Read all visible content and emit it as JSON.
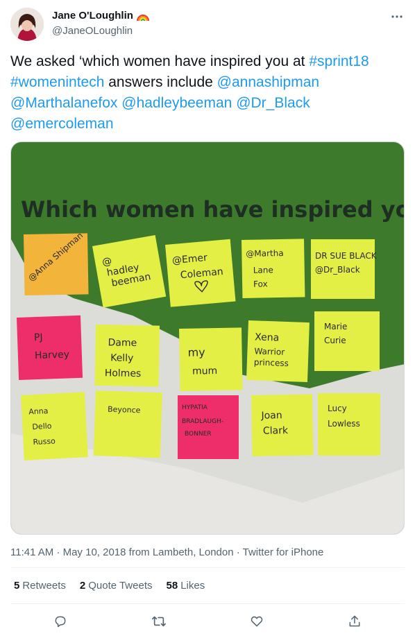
{
  "author": {
    "display_name": "Jane O'Loughlin",
    "handle": "@JaneOLoughlin",
    "badge_icon": "rainbow-icon"
  },
  "tweet": {
    "segments": [
      {
        "text": "We asked ‘which women have inspired you at ",
        "type": "text"
      },
      {
        "text": "#sprint18",
        "type": "link"
      },
      {
        "text": " ",
        "type": "text"
      },
      {
        "text": "#womenintech",
        "type": "link"
      },
      {
        "text": " answers include ",
        "type": "text"
      },
      {
        "text": "@annashipman",
        "type": "link"
      },
      {
        "text": " ",
        "type": "text"
      },
      {
        "text": "@Marthalanefox",
        "type": "link"
      },
      {
        "text": " ",
        "type": "text"
      },
      {
        "text": "@hadleybeeman",
        "type": "link"
      },
      {
        "text": " ",
        "type": "text"
      },
      {
        "text": "@Dr_Black",
        "type": "link"
      },
      {
        "text": " ",
        "type": "text"
      },
      {
        "text": "@emercoleman",
        "type": "link"
      }
    ]
  },
  "photo": {
    "heading": "Which women have inspired you",
    "notes": [
      "@Anna Shipman",
      "@hadley beeman",
      "@Emer Coleman",
      "@Martha Lane Fox",
      "DR SUE BLACK @Dr_Black",
      "PJ Harvey",
      "Dame Kelly Holmes",
      "my mum",
      "Xena Warrior princess",
      "Marie Curie",
      "Anna Dello Russo",
      "Beyonce",
      "HYPATIA BRADLAUGH-BONNER",
      "Joan Clark",
      "Lucy Lowless"
    ]
  },
  "meta": {
    "timestamp": "11:41 AM · May 10, 2018 from Lambeth, London · Twitter for iPhone"
  },
  "stats": {
    "retweets_count": "5",
    "retweets_label": "Retweets",
    "quotes_count": "2",
    "quotes_label": "Quote Tweets",
    "likes_count": "58",
    "likes_label": "Likes"
  },
  "colors": {
    "link": "#1d9bf0",
    "muted": "#536471",
    "wall_green": "#3e7a2c",
    "note_yellow": "#e4ef46",
    "note_orange": "#f2b43a",
    "note_pink": "#ee2e6b"
  }
}
